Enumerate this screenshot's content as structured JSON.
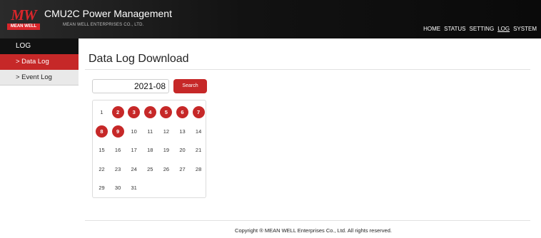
{
  "brand": {
    "logo_text": "MW",
    "logo_subtext": "MEAN WELL",
    "app_title": "CMU2C Power Management",
    "company": "MEAN WELL ENTERPRISES CO., LTD."
  },
  "nav": [
    "HOME",
    "STATUS",
    "SETTING",
    "LOG",
    "SYSTEM"
  ],
  "nav_active": "LOG",
  "sidebar": {
    "heading": "LOG",
    "items": [
      {
        "label": "> Data Log",
        "active": true
      },
      {
        "label": "> Event Log",
        "active": false
      }
    ]
  },
  "main": {
    "title": "Data Log Download",
    "month_value": "2021-08",
    "search_label": "Search"
  },
  "calendar": {
    "days": [
      1,
      2,
      3,
      4,
      5,
      6,
      7,
      8,
      9,
      10,
      11,
      12,
      13,
      14,
      15,
      16,
      17,
      18,
      19,
      20,
      21,
      22,
      23,
      24,
      25,
      26,
      27,
      28,
      29,
      30,
      31
    ],
    "available_days": [
      2,
      3,
      4,
      5,
      6,
      7,
      8,
      9
    ]
  },
  "footer": {
    "copyright": "Copyright ® MEAN WELL Enterprises Co., Ltd. All rights reserved."
  },
  "colors": {
    "accent": "#c62828",
    "header_bg": "#111111"
  }
}
